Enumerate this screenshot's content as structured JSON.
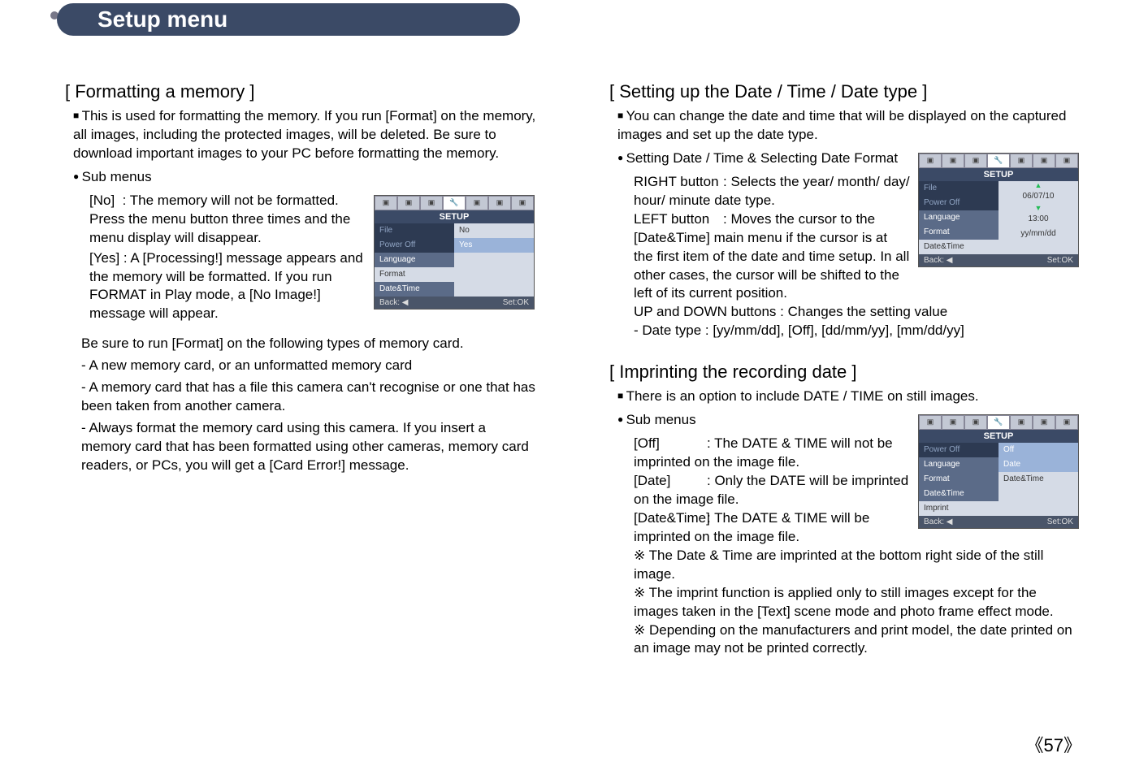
{
  "banner": {
    "title": "Setup menu"
  },
  "left": {
    "h_format": "[ Formatting a memory ]",
    "p_format_intro": "This is used for formatting the memory. If you run [Format] on the memory, all images, including the protected images, will be deleted. Be sure to download important images to your PC before formatting the memory.",
    "submenus_label": "Sub menus",
    "no_label": "[No]",
    "no_text": ": The memory will not be formatted. Press the menu button three times and the menu display will disappear.",
    "yes_label": "[Yes]",
    "yes_text": ": A [Processing!] message appears and the memory will be formatted. If you run FORMAT in Play mode, a [No Image!] message will appear.",
    "be_sure": "Be sure to run [Format] on the following types of memory card.",
    "n1": "- A new memory card, or an unformatted memory card",
    "n2": "- A memory card that has a file this camera can't recognise or one that has been taken from another camera.",
    "n3": "- Always format the memory card using this camera. If you insert a memory card that has been formatted using other cameras, memory card readers, or PCs, you will get a [Card Error!] message."
  },
  "right": {
    "h_date": "[ Setting up the Date / Time / Date type ]",
    "p_date_intro": "You can change the date and time that will be displayed on the captured images and set up the date type.",
    "p_setting": "Setting Date / Time & Selecting Date Format",
    "right_btn_lbl": "RIGHT button",
    "right_btn_txt": ": Selects the year/ month/ day/ hour/ minute date type.",
    "left_btn_lbl": "LEFT button",
    "left_btn_txt": ": Moves the cursor to the [Date&Time] main menu if the cursor is at the first item of the date and time setup. In all other cases, the cursor will be shifted to the left of its current position.",
    "updown": "UP and DOWN buttons : Changes the setting value",
    "datetype": "- Date type : [yy/mm/dd], [Off], [dd/mm/yy], [mm/dd/yy]",
    "h_imprint": "[ Imprinting the recording date ]",
    "p_imprint_intro": "There is an option to include DATE / TIME on still images.",
    "submenus_label2": "Sub menus",
    "off_lbl": "[Off]",
    "off_txt": ": The DATE & TIME will not be imprinted on the image file.",
    "date_lbl": "[Date]",
    "date_txt": ": Only the DATE will be imprinted on the image file.",
    "dt_lbl": "[Date&Time]",
    "dt_txt": ": The DATE & TIME will be imprinted on the image file.",
    "note1": "The Date & Time are imprinted at the bottom right side of the still image.",
    "note2": "The imprint function is applied only to still images except for the images taken in the [Text] scene mode and photo frame effect mode.",
    "note3": "Depending on the manufacturers and print model, the date printed on an image may not be printed correctly."
  },
  "menus": {
    "setup_title": "SETUP",
    "back": "Back: ◀",
    "setok": "Set:OK",
    "m1": {
      "left": [
        "File",
        "Power Off",
        "Language",
        "Format",
        "Date&Time"
      ],
      "right": [
        "No",
        "Yes"
      ]
    },
    "m2": {
      "left": [
        "File",
        "Power Off",
        "Language",
        "Format",
        "Date&Time"
      ],
      "right1": "06/07/10",
      "right2": "13:00",
      "right3": "yy/mm/dd"
    },
    "m3": {
      "left": [
        "Power Off",
        "Language",
        "Format",
        "Date&Time",
        "Imprint"
      ],
      "right": [
        "Off",
        "Date",
        "Date&Time"
      ]
    }
  },
  "pagenum": "《57》"
}
